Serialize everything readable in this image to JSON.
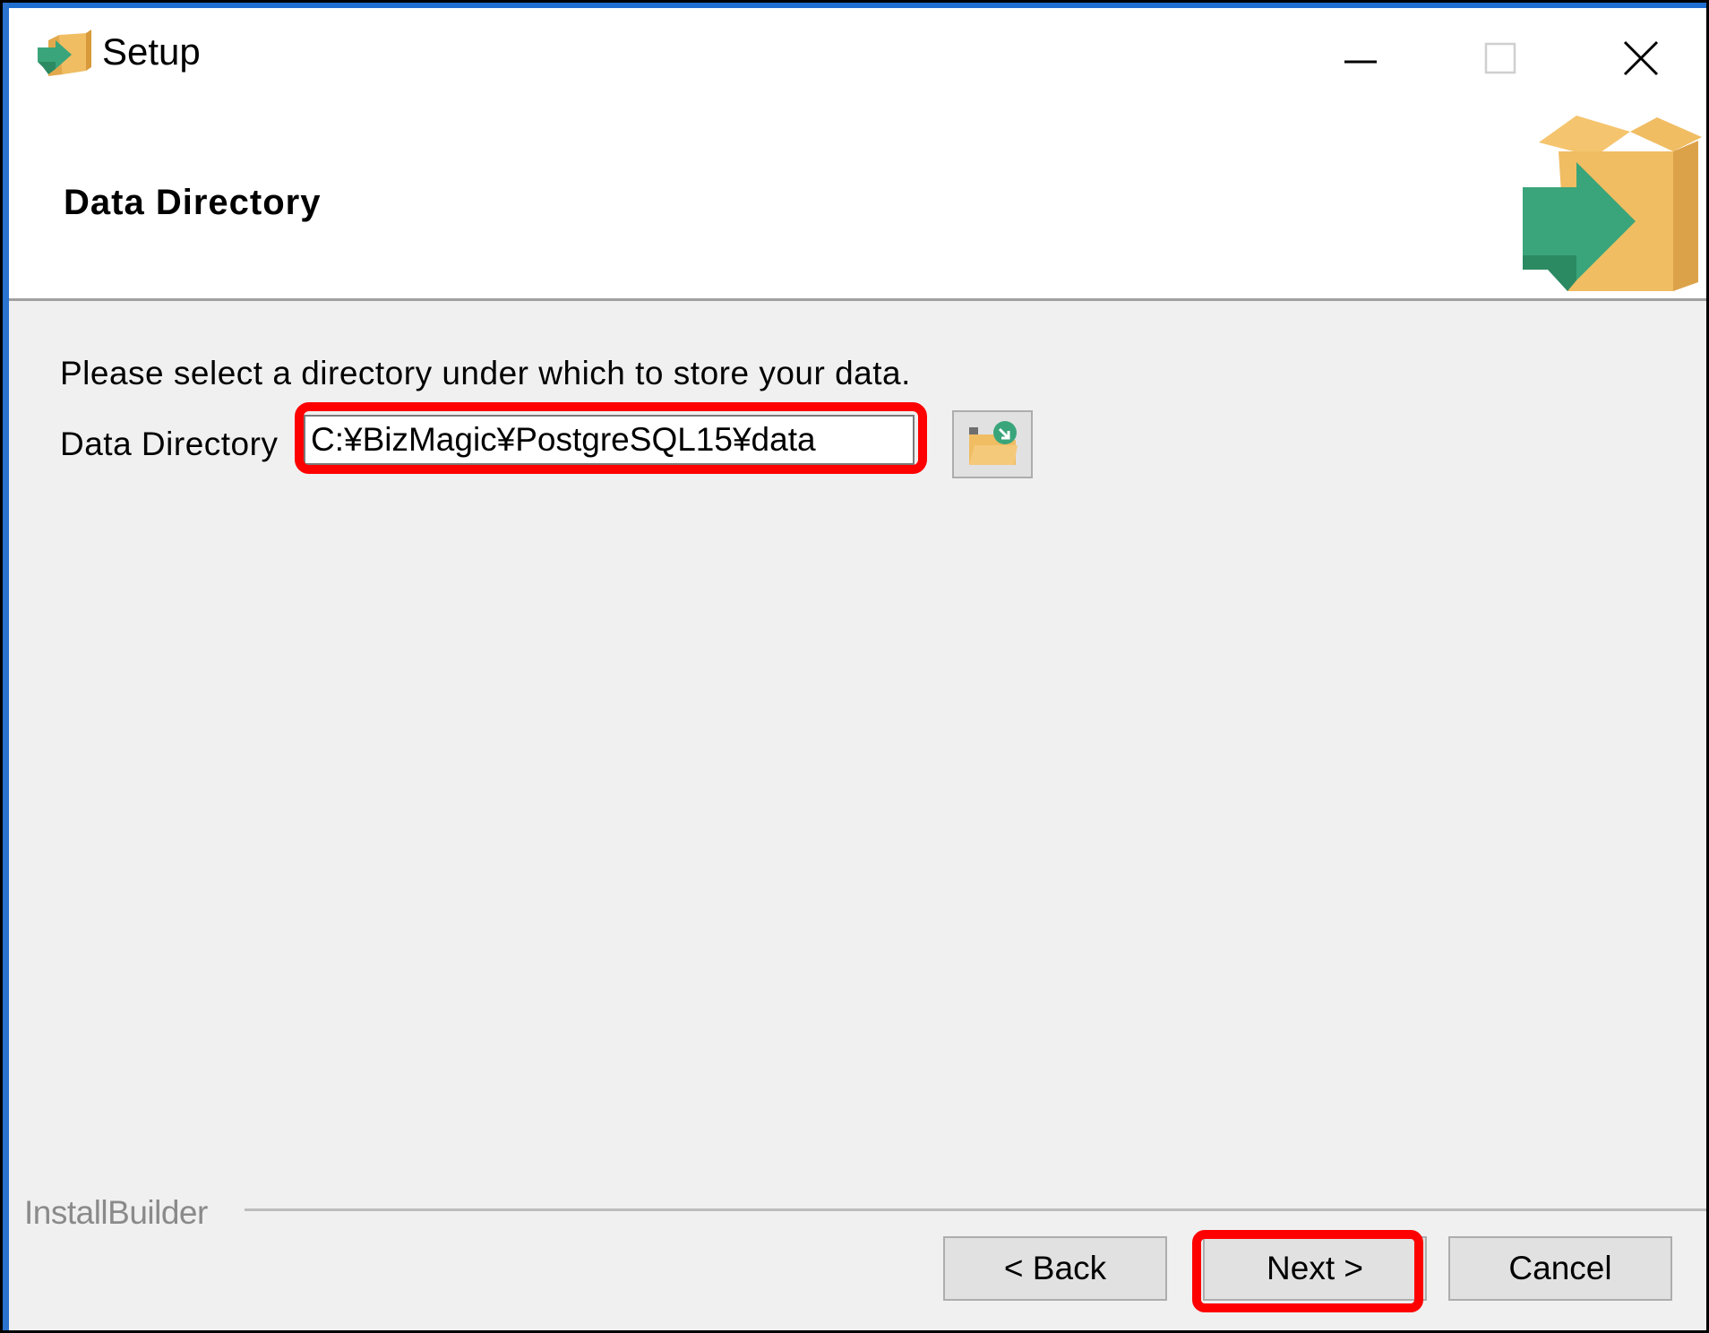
{
  "window": {
    "title": "Setup",
    "icon": "installer-box-icon",
    "controls": [
      "minimize-icon",
      "maximize-icon",
      "close-icon"
    ]
  },
  "header": {
    "title": "Data Directory",
    "logo": "installer-box-icon"
  },
  "body": {
    "prompt": "Please select a directory under which to store your data.",
    "field_label": "Data Directory",
    "field_value": "C:¥BizMagic¥PostgreSQL15¥data",
    "browse_icon": "folder-browse-icon"
  },
  "footer": {
    "brand": "InstallBuilder",
    "back_label": "< Back",
    "next_label": "Next >",
    "cancel_label": "Cancel"
  },
  "colors": {
    "highlight": "#ff0000",
    "window_accent": "#1f6fd0",
    "icon_green": "#3aa57a",
    "icon_box": "#f0bd63"
  }
}
